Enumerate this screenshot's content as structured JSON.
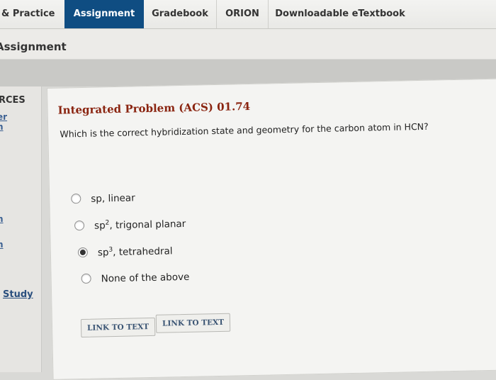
{
  "tabs": [
    {
      "label": "& Practice",
      "active": false
    },
    {
      "label": "Assignment",
      "active": true
    },
    {
      "label": "Gradebook",
      "active": false
    },
    {
      "label": "ORION",
      "active": false
    },
    {
      "label": "Downloadable eTextbook",
      "active": false
    }
  ],
  "section": {
    "title": "Assignment"
  },
  "sidebar": {
    "heading": "RCES",
    "links": [
      "er",
      "n",
      "",
      "",
      "n",
      "n"
    ],
    "study": "Study"
  },
  "question": {
    "title": "Integrated Problem (ACS) 01.74",
    "prompt": "Which is the correct hybridization state and geometry for the carbon atom in HCN?",
    "options": [
      {
        "base": "sp",
        "sup": "",
        "rest": ", linear",
        "selected": false
      },
      {
        "base": "sp",
        "sup": "2",
        "rest": ", trigonal planar",
        "selected": false
      },
      {
        "base": "sp",
        "sup": "3",
        "rest": ", tetrahedral",
        "selected": true
      },
      {
        "base": "None of the above",
        "sup": "",
        "rest": "",
        "selected": false
      }
    ]
  },
  "buttons": [
    "LINK TO TEXT",
    "LINK TO TEXT"
  ],
  "colors": {
    "active_tab": "#0f4d82",
    "question_title": "#8a2410",
    "link": "#3a5f91"
  }
}
